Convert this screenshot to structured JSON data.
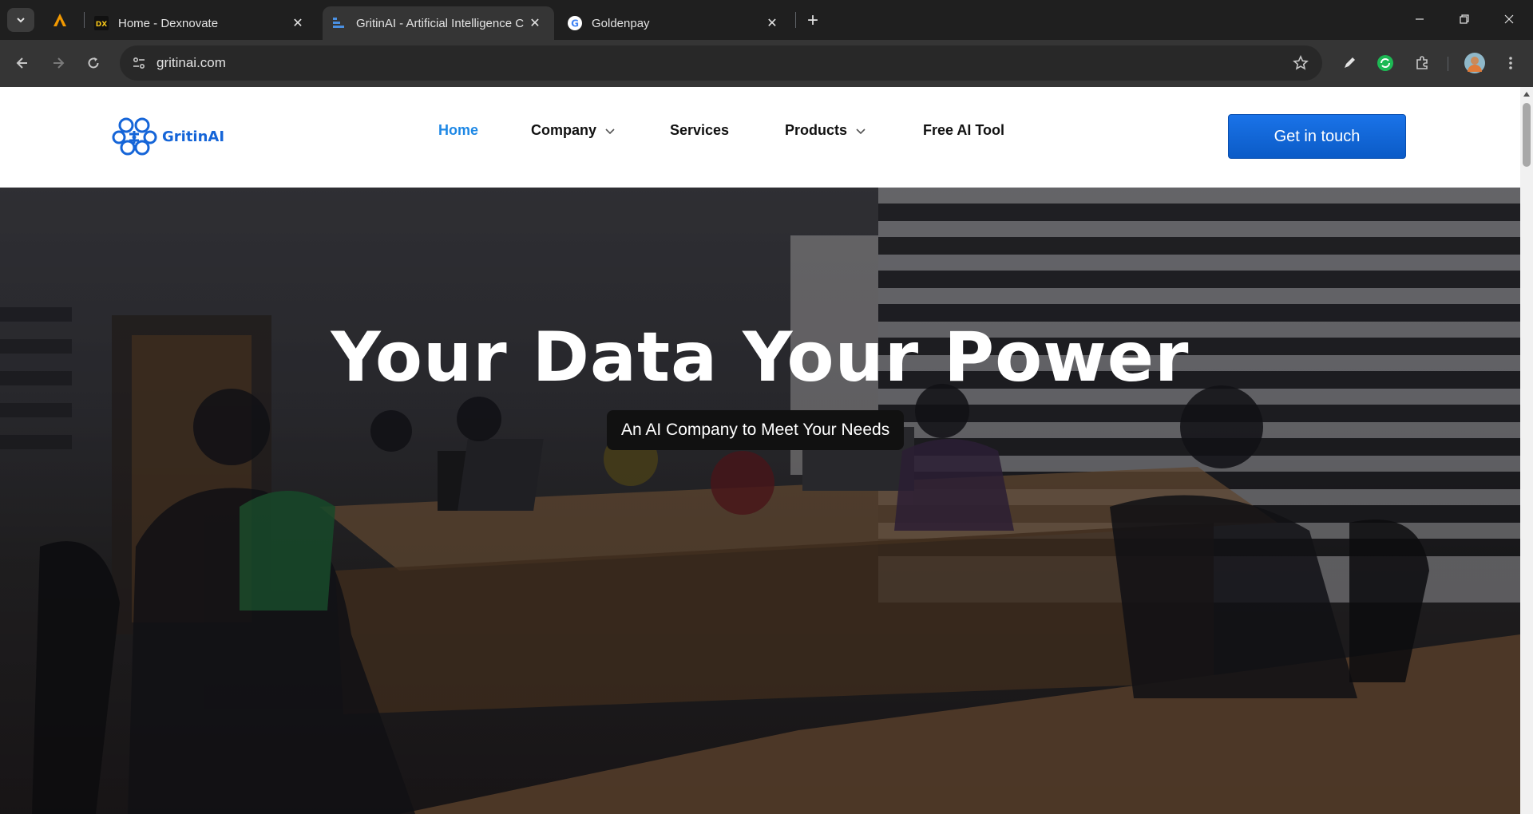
{
  "browser": {
    "tabs": [
      {
        "title": "Home - Dexnovate",
        "favicon": "dexnovate-favicon",
        "active": false
      },
      {
        "title": "GritinAI - Artificial Intelligence C",
        "favicon": "gritinai-favicon",
        "active": true
      },
      {
        "title": "Goldenpay",
        "favicon": "google-favicon",
        "active": false
      }
    ],
    "address": "gritinai.com"
  },
  "site": {
    "logo_text": "GritinAI",
    "nav": {
      "home": "Home",
      "company": "Company",
      "services": "Services",
      "products": "Products",
      "free_ai_tool": "Free AI Tool"
    },
    "cta": "Get in touch",
    "hero": {
      "headline": "Your Data Your Power",
      "subheadline": "An AI Company to Meet Your Needs"
    }
  },
  "colors": {
    "accent": "#1a73e8",
    "nav_active": "#1e88e5",
    "brand": "#1565d8"
  }
}
